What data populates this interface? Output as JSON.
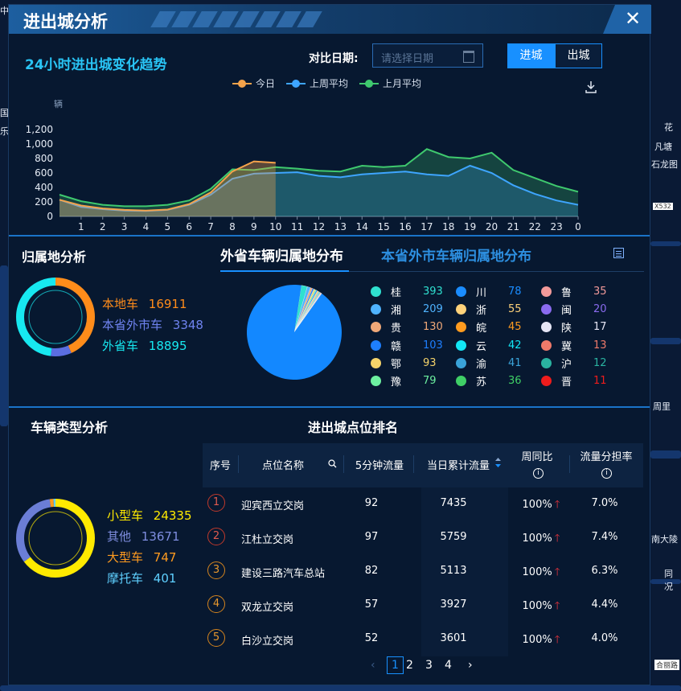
{
  "map": {
    "labels": [
      "中",
      "国",
      "乐",
      "花",
      "凡塘",
      "石龙图",
      "X532",
      "南大陵",
      "同况",
      "合丽路",
      "周里"
    ]
  },
  "window": {
    "title": "进出城分析",
    "close_symbol": "✕"
  },
  "trend": {
    "title": "24小时进出城变化趋势",
    "date_label": "对比日期:",
    "date_placeholder": "请选择日期",
    "toggle_in": "进城",
    "toggle_out": "出城",
    "legend": [
      {
        "name": "今日",
        "color": "#f5a34b"
      },
      {
        "name": "上周平均",
        "color": "#3ea5ff"
      },
      {
        "name": "上月平均",
        "color": "#3fc96e"
      }
    ],
    "unit": "辆"
  },
  "chart_data": {
    "type": "area",
    "ylabel": "辆",
    "ylim": [
      0,
      1300
    ],
    "yticks": [
      "0",
      "200",
      "400",
      "600",
      "800",
      "1,000",
      "1,200"
    ],
    "x_ticks": [
      "1",
      "2",
      "3",
      "4",
      "5",
      "6",
      "7",
      "8",
      "9",
      "10",
      "11",
      "12",
      "13",
      "14",
      "15",
      "16",
      "17",
      "18",
      "19",
      "20",
      "21",
      "22",
      "23",
      "0"
    ],
    "x": [
      0,
      1,
      2,
      3,
      4,
      5,
      6,
      7,
      8,
      9,
      10,
      11,
      12,
      13,
      14,
      15,
      16,
      17,
      18,
      19,
      20,
      21,
      22,
      23,
      24
    ],
    "series": [
      {
        "name": "今日",
        "color": "#f5a34b",
        "values": [
          230,
          150,
          110,
          90,
          80,
          95,
          170,
          330,
          620,
          760,
          740,
          null,
          null,
          null,
          null,
          null,
          null,
          null,
          null,
          null,
          null,
          null,
          null,
          null,
          null
        ]
      },
      {
        "name": "上周平均",
        "color": "#3ea5ff",
        "values": [
          230,
          130,
          100,
          80,
          75,
          90,
          160,
          300,
          520,
          590,
          600,
          610,
          560,
          540,
          580,
          600,
          620,
          580,
          560,
          700,
          600,
          430,
          310,
          220,
          160
        ]
      },
      {
        "name": "上月平均",
        "color": "#3fc96e",
        "values": [
          300,
          210,
          160,
          140,
          140,
          160,
          220,
          380,
          650,
          640,
          680,
          660,
          630,
          620,
          700,
          680,
          700,
          930,
          820,
          800,
          880,
          640,
          530,
          420,
          340
        ]
      }
    ]
  },
  "ownership": {
    "title": "归属地分析",
    "items": [
      {
        "label": "本地车",
        "value": "16911",
        "color": "#ff8c1a"
      },
      {
        "label": "本省外市车",
        "value": "3348",
        "color": "#5b6ee1"
      },
      {
        "label": "外省车",
        "value": "18895",
        "color": "#17e8f0"
      }
    ]
  },
  "tabs": {
    "active": "外省车辆归属地分布",
    "inactive": "本省外市车辆归属地分布"
  },
  "provinces": [
    {
      "name": "桂",
      "value": "393",
      "color": "#2fe0d0"
    },
    {
      "name": "湘",
      "value": "209",
      "color": "#4fb3ff"
    },
    {
      "name": "贵",
      "value": "130",
      "color": "#f0a878"
    },
    {
      "name": "赣",
      "value": "103",
      "color": "#1e7fff"
    },
    {
      "name": "鄂",
      "value": "93",
      "color": "#f5d36a"
    },
    {
      "name": "豫",
      "value": "79",
      "color": "#6df0a0"
    },
    {
      "name": "川",
      "value": "78",
      "color": "#1a8cff"
    },
    {
      "name": "浙",
      "value": "55",
      "color": "#ffd27a"
    },
    {
      "name": "皖",
      "value": "45",
      "color": "#ff9b1f"
    },
    {
      "name": "云",
      "value": "42",
      "color": "#12e6f5"
    },
    {
      "name": "渝",
      "value": "41",
      "color": "#3aa3d9"
    },
    {
      "name": "苏",
      "value": "36",
      "color": "#3fcf66"
    },
    {
      "name": "鲁",
      "value": "35",
      "color": "#f29a9a"
    },
    {
      "name": "闽",
      "value": "20",
      "color": "#8a6bef"
    },
    {
      "name": "陕",
      "value": "17",
      "color": "#e6e6f5"
    },
    {
      "name": "冀",
      "value": "13",
      "color": "#f07a6a"
    },
    {
      "name": "沪",
      "value": "12",
      "color": "#2ab3a0"
    },
    {
      "name": "晋",
      "value": "11",
      "color": "#ee1c1c"
    }
  ],
  "vehicle_types": {
    "title": "车辆类型分析",
    "items": [
      {
        "label": "小型车",
        "value": "24335",
        "color": "#ffea00"
      },
      {
        "label": "其他",
        "value": "13671",
        "color": "#6b7ed6"
      },
      {
        "label": "大型车",
        "value": "747",
        "color": "#ff9b1f"
      },
      {
        "label": "摩托车",
        "value": "401",
        "color": "#5fd0ff"
      }
    ]
  },
  "ranking": {
    "title": "进出城点位排名",
    "headers": {
      "no": "序号",
      "name": "点位名称",
      "flow5": "5分钟流量",
      "total": "当日累计流量",
      "yoy": "周同比",
      "share": "流量分担率"
    },
    "rows": [
      {
        "no": "1",
        "name": "迎宾西立交岗",
        "flow5": "92",
        "total": "7435",
        "yoy": "100%",
        "share": "7.0%"
      },
      {
        "no": "2",
        "name": "江杜立交岗",
        "flow5": "97",
        "total": "5759",
        "yoy": "100%",
        "share": "7.4%"
      },
      {
        "no": "3",
        "name": "建设三路汽车总站",
        "flow5": "82",
        "total": "5113",
        "yoy": "100%",
        "share": "6.3%"
      },
      {
        "no": "4",
        "name": "双龙立交岗",
        "flow5": "57",
        "total": "3927",
        "yoy": "100%",
        "share": "4.4%"
      },
      {
        "no": "5",
        "name": "白沙立交岗",
        "flow5": "52",
        "total": "3601",
        "yoy": "100%",
        "share": "4.0%"
      }
    ],
    "pages": [
      "1",
      "2",
      "3",
      "4"
    ],
    "current_page": "1"
  }
}
